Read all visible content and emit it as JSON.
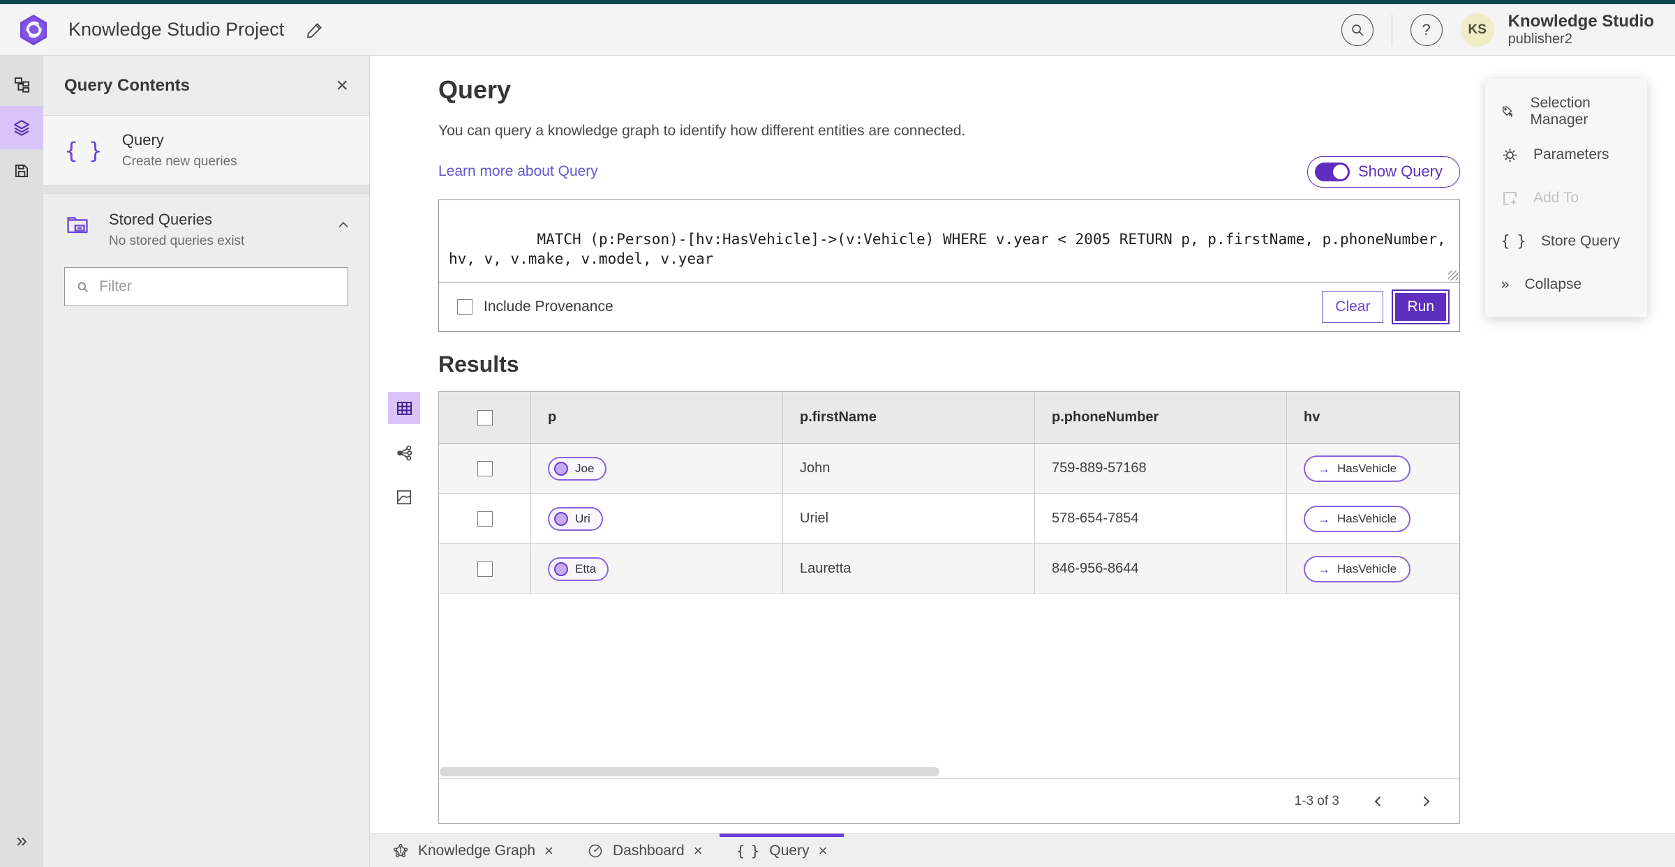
{
  "header": {
    "app_title": "Knowledge Studio Project",
    "user": {
      "initials": "KS",
      "name": "Knowledge Studio",
      "role": "publisher2"
    }
  },
  "query_contents": {
    "title": "Query Contents",
    "query_item": {
      "label": "Query",
      "description": "Create new queries"
    },
    "stored_queries": {
      "label": "Stored Queries",
      "description": "No stored queries exist"
    },
    "filter": {
      "placeholder": "Filter"
    }
  },
  "query_panel": {
    "title": "Query",
    "description": "You can query a knowledge graph to identify how different entities are connected.",
    "learn_more": "Learn more about Query",
    "show_query_label": "Show Query",
    "query_text": "MATCH (p:Person)-[hv:HasVehicle]->(v:Vehicle) WHERE v.year < 2005 RETURN p, p.firstName, p.phoneNumber, hv, v, v.make, v.model, v.year",
    "include_provenance_label": "Include Provenance",
    "clear_label": "Clear",
    "run_label": "Run"
  },
  "results": {
    "title": "Results",
    "columns": [
      "p",
      "p.firstName",
      "p.phoneNumber",
      "hv"
    ],
    "rows": [
      {
        "p": "Joe",
        "firstName": "John",
        "phoneNumber": "759-889-57168",
        "hv": "HasVehicle"
      },
      {
        "p": "Uri",
        "firstName": "Uriel",
        "phoneNumber": "578-654-7854",
        "hv": "HasVehicle"
      },
      {
        "p": "Etta",
        "firstName": "Lauretta",
        "phoneNumber": "846-956-8644",
        "hv": "HasVehicle"
      }
    ],
    "pagination": {
      "label": "1-3 of 3"
    }
  },
  "tools_panel": {
    "items": [
      {
        "label": "Selection Manager"
      },
      {
        "label": "Parameters"
      },
      {
        "label": "Add To"
      },
      {
        "label": "Store Query"
      },
      {
        "label": "Collapse"
      }
    ]
  },
  "tabs": [
    {
      "label": "Knowledge Graph"
    },
    {
      "label": "Dashboard"
    },
    {
      "label": "Query"
    }
  ],
  "icons": {
    "close": "×",
    "braces": "{ }",
    "collapse_right": "»",
    "arrow_right": "→",
    "help": "?"
  },
  "colors": {
    "accent": "#5e2ebe",
    "accent_light": "#d8c4f8",
    "link": "#6355d4",
    "top_strip": "#11484e"
  }
}
